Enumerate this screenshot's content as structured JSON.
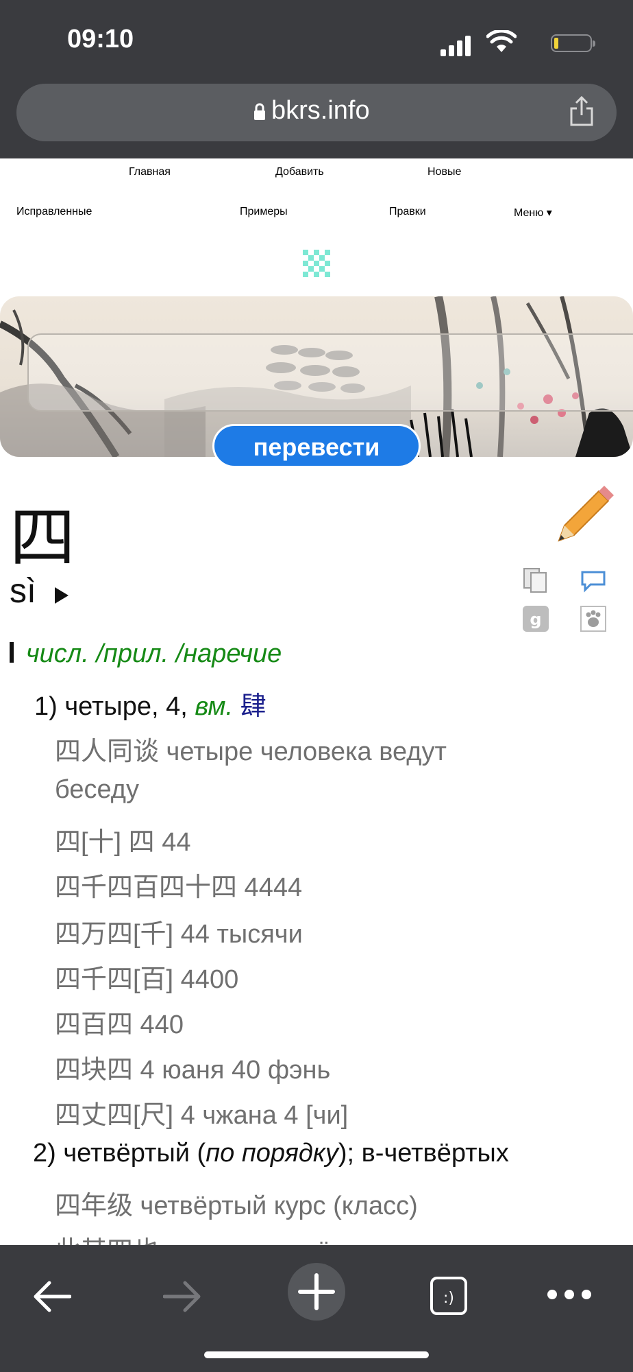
{
  "status_bar": {
    "time": "09:10"
  },
  "browser": {
    "url": "bkrs.info"
  },
  "nav": {
    "row1": [
      "Главная",
      "Добавить",
      "Новые"
    ],
    "row2": [
      "Исправленные",
      "Примеры",
      "Правки",
      "Меню ▾"
    ]
  },
  "search": {
    "placeholder": "",
    "button_label": "перевести"
  },
  "entry": {
    "headword": "四",
    "pinyin": "sì",
    "pos_marker": "I",
    "pos_label": "числ. /прил. /наречие",
    "sense1": {
      "number": "1)",
      "text": "четыре, 4,",
      "ref_label": "вм.",
      "ref_char": "肆"
    },
    "examples1": [
      "四人同谈 четыре человека ведут",
      "беседу",
      "四[十] 四 44",
      "四千四百四十四 4444",
      "四万四[千] 44 тысячи",
      "四千四[百] 4400",
      "四百四 440",
      "四块四 4 юаня 40 фэнь",
      "四丈四[尺] 4 чжана 4 [чи]"
    ],
    "sense2": {
      "number": "2)",
      "text_before": "четвёртый (",
      "text_italic": "по порядку",
      "text_after": "); в-четвёртых"
    },
    "examples2": [
      "四年级 четвёртый курс (класс)",
      "此其四也 это ... в-четвёртых"
    ]
  },
  "icons": {
    "accent": "#1e7be6",
    "link_color": "#1a1f8c",
    "pos_color": "#168a16",
    "example_color": "#707070"
  }
}
